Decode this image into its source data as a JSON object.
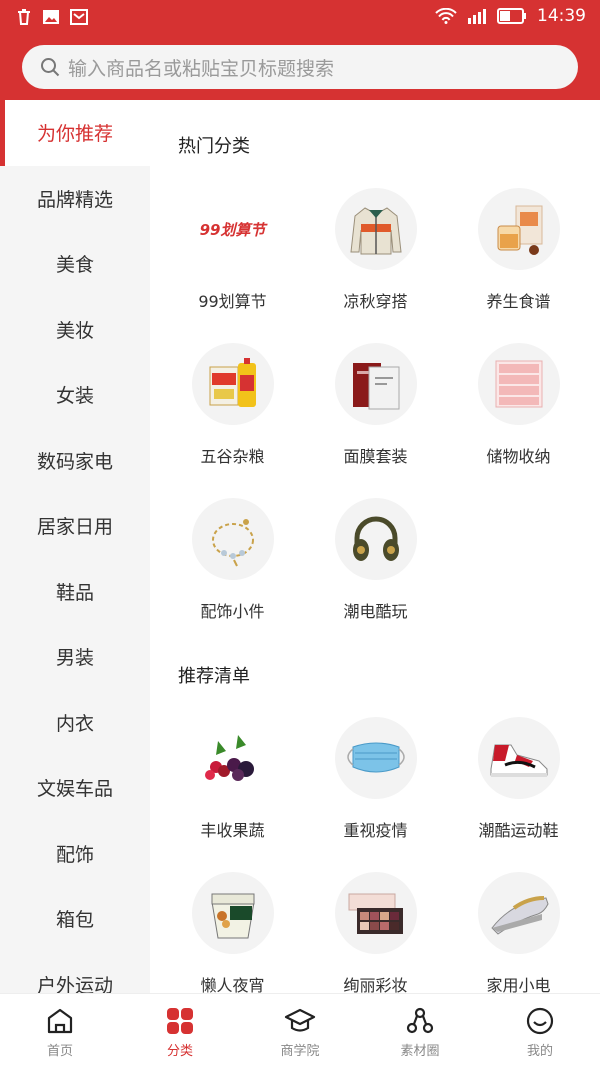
{
  "status": {
    "time": "14:39"
  },
  "search": {
    "placeholder": "输入商品名或粘贴宝贝标题搜索"
  },
  "sidebar": {
    "items": [
      {
        "label": "为你推荐"
      },
      {
        "label": "品牌精选"
      },
      {
        "label": "美食"
      },
      {
        "label": "美妆"
      },
      {
        "label": "女装"
      },
      {
        "label": "数码家电"
      },
      {
        "label": "居家日用"
      },
      {
        "label": "鞋品"
      },
      {
        "label": "男装"
      },
      {
        "label": "内衣"
      },
      {
        "label": "文娱车品"
      },
      {
        "label": "配饰"
      },
      {
        "label": "箱包"
      },
      {
        "label": "户外运动"
      }
    ]
  },
  "hot": {
    "title": "热门分类",
    "items": [
      {
        "label": "99划算节",
        "logo": "99划算节"
      },
      {
        "label": "凉秋穿搭"
      },
      {
        "label": "养生食谱"
      },
      {
        "label": "五谷杂粮"
      },
      {
        "label": "面膜套装"
      },
      {
        "label": "储物收纳"
      },
      {
        "label": "配饰小件"
      },
      {
        "label": "潮电酷玩"
      }
    ]
  },
  "recommend": {
    "title": "推荐清单",
    "items": [
      {
        "label": "丰收果蔬"
      },
      {
        "label": "重视疫情"
      },
      {
        "label": "潮酷运动鞋"
      },
      {
        "label": "懒人夜宵"
      },
      {
        "label": "绚丽彩妆"
      },
      {
        "label": "家用小电"
      }
    ]
  },
  "tabbar": {
    "items": [
      {
        "label": "首页",
        "icon": "home-icon"
      },
      {
        "label": "分类",
        "icon": "category-icon"
      },
      {
        "label": "商学院",
        "icon": "graduation-cap-icon"
      },
      {
        "label": "素材圈",
        "icon": "share-circle-icon"
      },
      {
        "label": "我的",
        "icon": "smile-icon"
      }
    ]
  },
  "colors": {
    "brand": "#d63232",
    "sidebar_bg": "#f5f5f5"
  }
}
